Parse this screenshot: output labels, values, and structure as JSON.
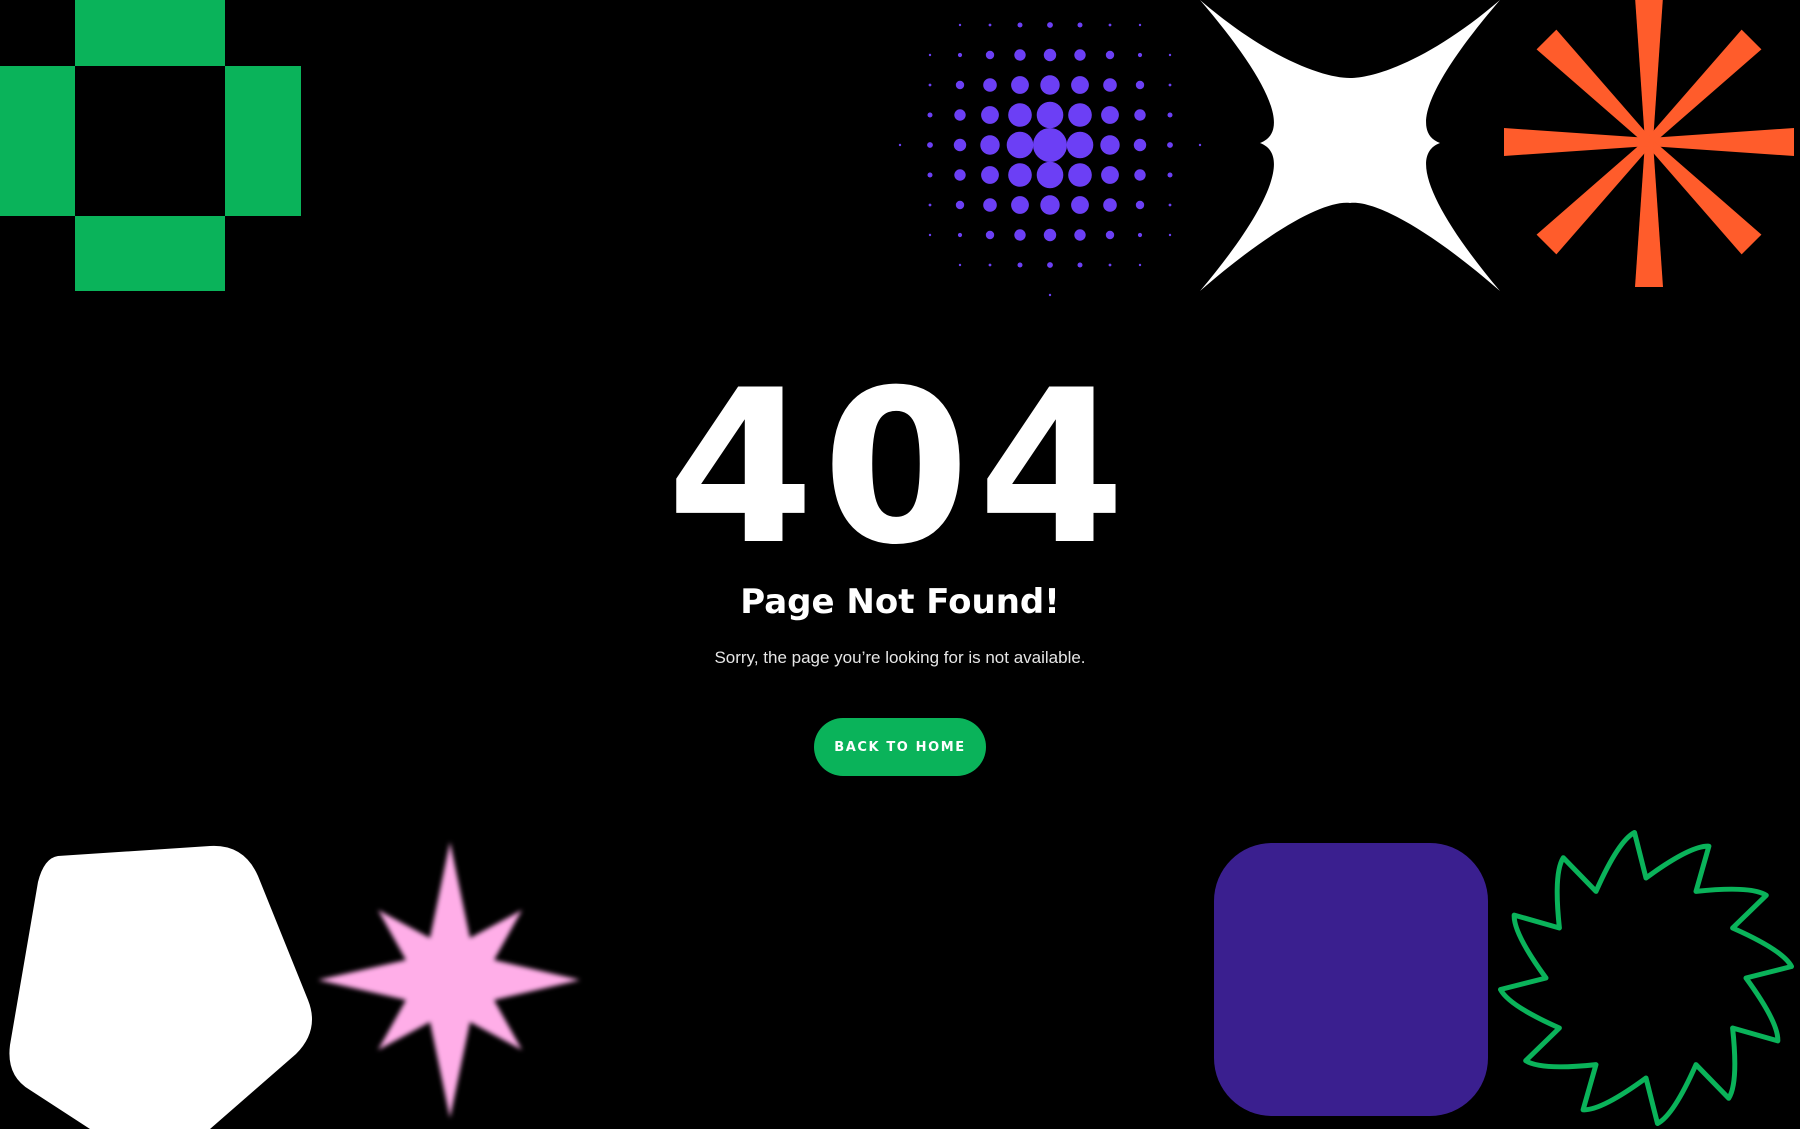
{
  "error": {
    "code": "404",
    "title": "Page Not Found!",
    "message": "Sorry, the page you’re looking for is not available."
  },
  "actions": {
    "home_label": "BACK TO HOME"
  },
  "colors": {
    "background": "#000000",
    "accent_green": "#0ab35a",
    "purple": "#6c3ff5",
    "deep_purple": "#3a1f8f",
    "orange": "#ff5c2b",
    "pink": "#ffaee8",
    "white": "#ffffff"
  },
  "decorations": [
    "green-pixel-ring",
    "purple-halftone-dots",
    "white-four-point-sparkle",
    "orange-asterisk",
    "white-pentagon",
    "pink-eight-point-star",
    "purple-rounded-square",
    "green-outline-sawblade"
  ]
}
